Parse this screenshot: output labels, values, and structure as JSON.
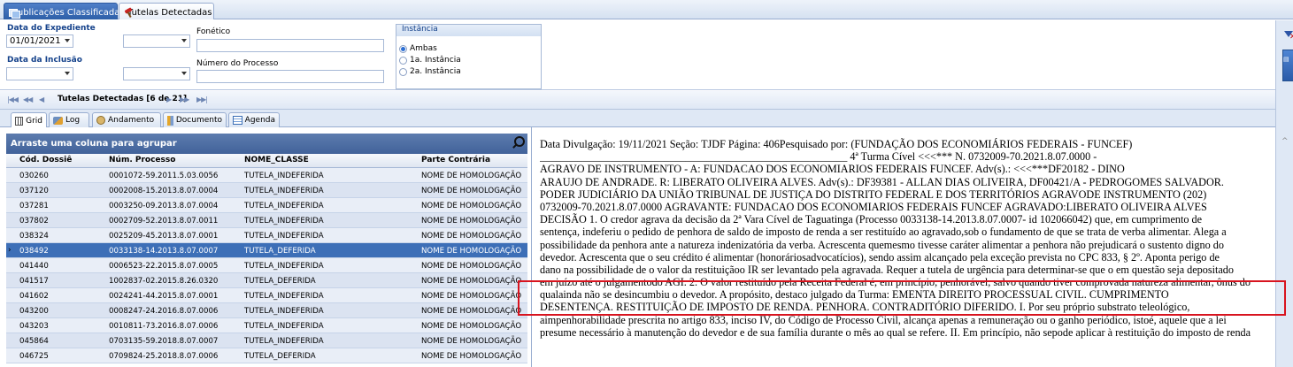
{
  "top_tabs": [
    {
      "label": "Publicações Classificadas",
      "active": true
    },
    {
      "label": "Tutelas Detectadas",
      "active": false
    }
  ],
  "filters": {
    "data_expediente_label": "Data do Expediente",
    "data_expediente_from": "01/01/2021",
    "data_expediente_to": "",
    "data_inclusao_label": "Data da Inclusão",
    "data_inclusao_from": "",
    "data_inclusao_to": "",
    "fonetico_label": "Fonético",
    "fonetico_value": "",
    "numero_processo_label": "Número do Processo",
    "numero_processo_value": "",
    "instancia_label": "Instância",
    "instancia_options": [
      "Ambas",
      "1a. Instância",
      "2a. Instância"
    ],
    "instancia_selected": "Ambas"
  },
  "navigator": {
    "title": "Tutelas Detectadas [6 de 21]"
  },
  "sub_tabs": [
    {
      "label": "Grid",
      "icon": "grid-icon",
      "active": true
    },
    {
      "label": "Log",
      "icon": "log-icon",
      "active": false
    },
    {
      "label": "Andamento",
      "icon": "andamento-icon",
      "active": false
    },
    {
      "label": "Documento",
      "icon": "documento-icon",
      "active": false
    },
    {
      "label": "Agenda",
      "icon": "agenda-icon",
      "active": false
    }
  ],
  "grid": {
    "group_bar_text": "Arraste uma coluna para agrupar",
    "columns": [
      "Cód. Dossiê",
      "Núm. Processo",
      "NOME_CLASSE",
      "Parte Contrária"
    ],
    "rows": [
      {
        "dossie": "030260",
        "processo": "0001072-59.2011.5.03.0056",
        "classe": "TUTELA_INDEFERIDA",
        "parte": "NOME DE HOMOLOGAÇÃO",
        "selected": false
      },
      {
        "dossie": "037120",
        "processo": "0002008-15.2013.8.07.0004",
        "classe": "TUTELA_INDEFERIDA",
        "parte": "NOME DE HOMOLOGAÇÃO",
        "selected": false
      },
      {
        "dossie": "037281",
        "processo": "0003250-09.2013.8.07.0004",
        "classe": "TUTELA_INDEFERIDA",
        "parte": "NOME DE HOMOLOGAÇÃO",
        "selected": false
      },
      {
        "dossie": "037802",
        "processo": "0002709-52.2013.8.07.0011",
        "classe": "TUTELA_INDEFERIDA",
        "parte": "NOME DE HOMOLOGAÇÃO",
        "selected": false
      },
      {
        "dossie": "038324",
        "processo": "0025209-45.2013.8.07.0001",
        "classe": "TUTELA_INDEFERIDA",
        "parte": "NOME DE HOMOLOGAÇÃO",
        "selected": false
      },
      {
        "dossie": "038492",
        "processo": "0033138-14.2013.8.07.0007",
        "classe": "TUTELA_DEFERIDA",
        "parte": "NOME DE HOMOLOGAÇÃO",
        "selected": true
      },
      {
        "dossie": "041440",
        "processo": "0006523-22.2015.8.07.0005",
        "classe": "TUTELA_INDEFERIDA",
        "parte": "NOME DE HOMOLOGAÇÃO",
        "selected": false
      },
      {
        "dossie": "041517",
        "processo": "1002837-02.2015.8.26.0320",
        "classe": "TUTELA_DEFERIDA",
        "parte": "NOME DE HOMOLOGAÇÃO",
        "selected": false
      },
      {
        "dossie": "041602",
        "processo": "0024241-44.2015.8.07.0001",
        "classe": "TUTELA_INDEFERIDA",
        "parte": "NOME DE HOMOLOGAÇÃO",
        "selected": false
      },
      {
        "dossie": "043200",
        "processo": "0008247-24.2016.8.07.0006",
        "classe": "TUTELA_INDEFERIDA",
        "parte": "NOME DE HOMOLOGAÇÃO",
        "selected": false
      },
      {
        "dossie": "043203",
        "processo": "0010811-73.2016.8.07.0006",
        "classe": "TUTELA_INDEFERIDA",
        "parte": "NOME DE HOMOLOGAÇÃO",
        "selected": false
      },
      {
        "dossie": "045864",
        "processo": "0703135-59.2018.8.07.0007",
        "classe": "TUTELA_INDEFERIDA",
        "parte": "NOME DE HOMOLOGAÇÃO",
        "selected": false
      },
      {
        "dossie": "046725",
        "processo": "0709824-25.2018.8.07.0006",
        "classe": "TUTELA_DEFERIDA",
        "parte": "NOME DE HOMOLOGAÇÃO",
        "selected": false
      }
    ]
  },
  "document": {
    "lines": [
      "Data Divulgação: 19/11/2021 Seção: TJDF Página: 406Pesquisado por: (FUNDAÇÃO DOS ECONOMIÁRIOS FEDERAIS - FUNCEF)",
      "_________________________________________________________ 4ª Turma Cível <<<*** N. 0732009-70.2021.8.07.0000 -",
      "AGRAVO DE INSTRUMENTO - A: FUNDACAO DOS ECONOMIARIOS FEDERAIS FUNCEF. Adv(s).: <<<***DF20182 - DINO",
      "ARAUJO DE ANDRADE. R: LIBERATO OLIVEIRA ALVES. Adv(s).: DF39381 - ALLAN DIAS OLIVEIRA, DF00421/A - PEDROGOMES SALVADOR.",
      "PODER JUDICIÁRIO DA UNIÃO TRIBUNAL DE JUSTIÇA DO DISTRITO FEDERAL E DOS TERRITÓRIOS AGRAVODE INSTRUMENTO (202)",
      "0732009-70.2021.8.07.0000 AGRAVANTE: FUNDACAO DOS ECONOMIARIOS FEDERAIS FUNCEF AGRAVADO:LIBERATO OLIVEIRA ALVES",
      "DECISÃO 1. O credor agrava da decisão da 2ª Vara Cível de Taguatinga (Processo 0033138-14.2013.8.07.0007- id 102066042) que, em cumprimento de",
      "sentença, indeferiu o pedido de penhora de saldo de imposto de renda a ser restituído ao agravado,sob o fundamento de que se trata de verba alimentar. Alega a",
      "possibilidade da penhora ante a natureza indenizatória da verba. Acrescenta quemesmo tivesse caráter alimentar a penhora não prejudicará o sustento digno do",
      "devedor. Acrescenta que o seu crédito é alimentar (honoráriosadvocatícios), sendo assim alcançado pela exceção prevista no CPC 833, § 2º. Aponta perigo de",
      "dano na possibilidade de o valor da restituiçãoo IR ser levantado pela agravada. Requer a tutela de urgência para determinar-se que o em questão seja depositado",
      "em juízo até o julgamentodo AGI. 2. O valor restituído pela Receita Federal é, em princípio, penhorável, salvo quando tiver comprovada natureza alimentar, ônus do",
      "qualainda não se desincumbiu o devedor. A propósito, destaco julgado da Turma: EMENTA DIREITO PROCESSUAL CIVIL. CUMPRIMENTO",
      "DESENTENÇA. RESTITUIÇÃO DE IMPOSTO DE RENDA. PENHORA. CONTRADITÓRIO DIFERIDO. I. Por seu próprio substrato teleológico,",
      "aimpenhorabilidade prescrita no artigo 833, inciso IV, do Código de Processo Civil, alcança apenas a remuneração ou o ganho periódico, istoé, aquele que a lei",
      "presume necessário à manutenção do devedor e de sua família durante o mês ao qual se refere. II. Em princípio, não sepode aplicar à restituição do imposto de renda"
    ]
  }
}
